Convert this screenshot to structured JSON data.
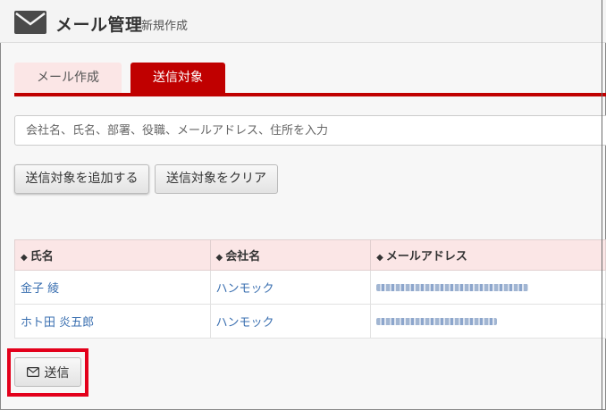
{
  "header": {
    "title": "メール管理",
    "subtitle": "新規作成",
    "icon": "mail-icon"
  },
  "tabs": [
    {
      "label": "メール作成",
      "active": false
    },
    {
      "label": "送信対象",
      "active": true
    }
  ],
  "search": {
    "placeholder": "会社名、氏名、部署、役職、メールアドレス、住所を入力",
    "value": ""
  },
  "buttons": {
    "add_label": "送信対象を追加する",
    "clear_label": "送信対象をクリア",
    "send_label": "送信"
  },
  "table": {
    "columns": [
      "氏名",
      "会社名",
      "メールアドレス"
    ],
    "rows": [
      {
        "name": "金子 綾",
        "company": "ハンモック"
      },
      {
        "name": "ホト田 炎五郎",
        "company": "ハンモック"
      }
    ]
  },
  "colors": {
    "accent": "#c00000",
    "tab_inactive": "#fbe6e6",
    "link": "#3a6fb0",
    "highlight": "#e3001b"
  }
}
